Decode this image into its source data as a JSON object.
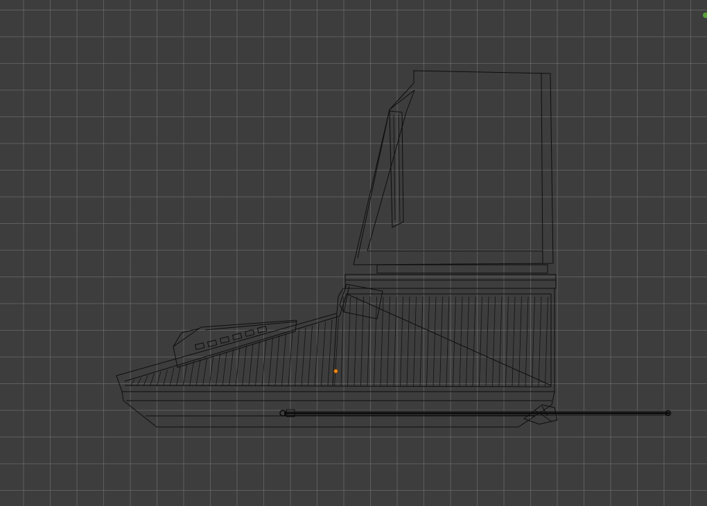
{
  "viewport": {
    "mode": "wireframe",
    "view": "side-orthographic",
    "background_color": "#3d3d3d",
    "grid_color": "#787878",
    "wire_color": "#0d0d0d",
    "origin_color": "#f28a20"
  },
  "scene": {
    "object": "retro-computer-model",
    "parts": [
      "monitor",
      "monitor-stand",
      "keyboard-base",
      "cable"
    ]
  }
}
